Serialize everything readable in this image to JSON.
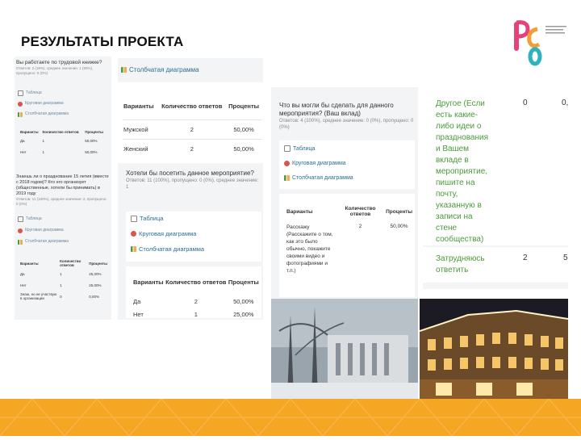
{
  "slide": {
    "title": "РЕЗУЛЬТАТЫ ПРОЕКТА",
    "logo_text": "РСО"
  },
  "colors": {
    "accent": "#f5a623",
    "link": "#2a6f8e",
    "green_answer": "#4b9a3a",
    "logo_pink": "#e6417b",
    "logo_orange": "#f29d38",
    "logo_teal": "#2bb3c0"
  },
  "left_panel": {
    "question1": "Вы работаете по трудовой книжке?",
    "question1_stats": "Ответов: 2 (18%), среднее значение: 1 (50%), пропущено: 0 (0%)",
    "links1": [
      "Таблица",
      "Круговая диаграмма",
      "Столбчатая диаграмма"
    ],
    "table1": {
      "headers": [
        "Варианты",
        "Количество ответов",
        "Проценты"
      ],
      "rows": [
        [
          "Да",
          "1",
          "50,00%"
        ],
        [
          "Нет",
          "1",
          "50,00%"
        ]
      ]
    },
    "question2": "Знаешь ли о празднование 15 летия (вместе с 2018 годом)? Кто его организует (общественные, хотели бы принимать) в 2019 году",
    "question2_stats": "Ответов: 11 (100%), среднее значение: 2, пропущено: 0 (0%)",
    "links2": [
      "Таблица",
      "Круговая диаграмма",
      "Столбчатая диаграмма"
    ],
    "table2": {
      "headers": [
        "Варианты",
        "Количество ответов",
        "Проценты"
      ],
      "rows": [
        [
          "Да",
          "1",
          "25,00%"
        ],
        [
          "Нет",
          "1",
          "25,00%"
        ],
        [
          "Знаю, но не участвую в организации",
          "0",
          "0,00%"
        ]
      ]
    }
  },
  "middle_panel": {
    "link_bar": "Столбчатая диаграмма",
    "table_gender": {
      "headers": [
        "Варианты",
        "Количество ответов",
        "Проценты"
      ],
      "rows": [
        [
          "Мужской",
          "2",
          "50,00%"
        ],
        [
          "Женский",
          "2",
          "50,00%"
        ]
      ]
    },
    "question": "Хотели бы посетить данное мероприятие?",
    "question_stats": "Ответов: 11 (100%), пропущено: 0 (0%), среднее значение: 1",
    "links": [
      "Таблица",
      "Круговая диаграмма",
      "Столбчатая диаграмма"
    ],
    "table_visit": {
      "headers": [
        "Варианты",
        "Количество ответов",
        "Проценты"
      ],
      "rows": [
        [
          "Да",
          "2",
          "50,00%"
        ],
        [
          "Нет",
          "1",
          "25,00%"
        ]
      ]
    }
  },
  "right_panel": {
    "question": "Что вы могли бы сделать для данного мероприятия? (Ваш вклад)",
    "question_stats": "Ответов: 4 (100%), среднее значение: 0 (0%), пропущено: 0 (0%)",
    "links": [
      "Таблица",
      "Круговая диаграмма",
      "Столбчатая диаграмма"
    ],
    "table": {
      "headers": [
        "Варианты",
        "Количество ответов",
        "Проценты"
      ],
      "rows": [
        [
          "Расскажу (Расскажите о том, как это было обычно, покажите своими видео и фотографиями и т.п.)",
          "2",
          "50,00%"
        ]
      ]
    }
  },
  "far_right": {
    "row1_text": "Другое (Если есть какие-либо идеи о празднования и Вашем вкладе в мероприятие, пишите на почту, указанную в записи на стене сообщества)",
    "row1_count": "0",
    "row1_percent": "0,",
    "row2_text": "Затрудняюсь ответить",
    "row2_count": "2",
    "row2_percent": "5"
  }
}
